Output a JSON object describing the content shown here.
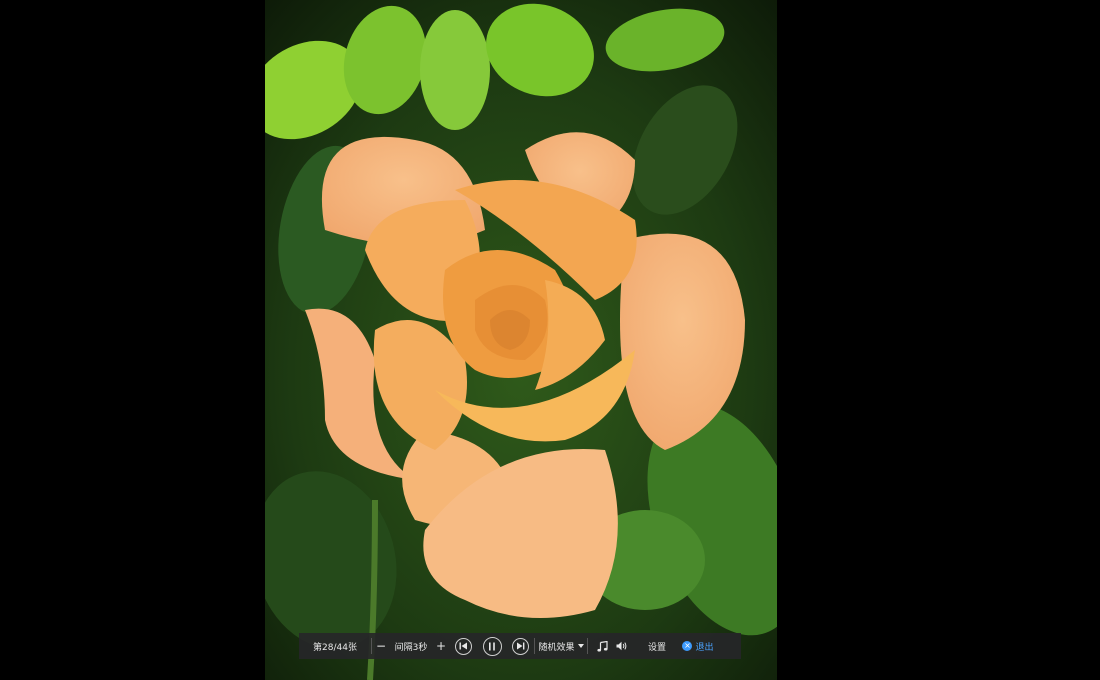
{
  "viewer": {
    "photo_alt": "orange rose",
    "counter": "第28/44张",
    "decrease_label": "−",
    "interval": "间隔3秒",
    "increase_label": "+",
    "effect": "随机效果",
    "settings": "设置",
    "exit": "退出",
    "exit_icon": "×"
  },
  "colors": {
    "background": "#000000",
    "toolbar": "#262628",
    "exit_accent": "#3d9bff"
  }
}
